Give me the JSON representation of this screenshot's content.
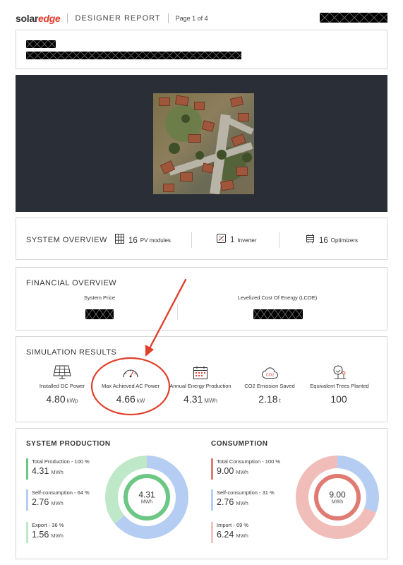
{
  "header": {
    "logo_solar": "solar",
    "logo_edge": "edge",
    "title": "DESIGNER REPORT",
    "page": "Page 1 of 4"
  },
  "system_overview": {
    "title": "SYSTEM OVERVIEW",
    "items": [
      {
        "count": "16",
        "label": "PV modules",
        "icon": "pv-grid-icon"
      },
      {
        "count": "1",
        "label": "Inverter",
        "icon": "inverter-icon"
      },
      {
        "count": "16",
        "label": "Optimizers",
        "icon": "optimizer-icon"
      }
    ]
  },
  "financial_overview": {
    "title": "FINANCIAL OVERVIEW",
    "system_price_label": "System Price",
    "lcoe_label": "Levelized Cost Of Energy (LCOE)"
  },
  "simulation_results": {
    "title": "SIMULATION RESULTS",
    "items": [
      {
        "label": "Installed DC Power",
        "value": "4.80",
        "unit": "kWp",
        "icon": "solar-panel-icon"
      },
      {
        "label": "Max Achieved AC Power",
        "value": "4.66",
        "unit": "kW",
        "icon": "gauge-icon"
      },
      {
        "label": "Annual Energy Production",
        "value": "4.31",
        "unit": "MWh",
        "icon": "calendar-icon"
      },
      {
        "label": "CO2 Emission Saved",
        "value": "2.18",
        "unit": "t",
        "icon": "co2-cloud-icon"
      },
      {
        "label": "Equivalent Trees Planted",
        "value": "100",
        "unit": "",
        "icon": "trees-icon"
      }
    ]
  },
  "system_production": {
    "title": "SYSTEM PRODUCTION",
    "center_value": "4.31",
    "center_unit": "MWh",
    "legend": [
      {
        "label": "Total Production - 100 %",
        "value": "4.31",
        "unit": "MWh",
        "color": "#6cc784"
      },
      {
        "label": "Self-consumption - 64 %",
        "value": "2.76",
        "unit": "MWh",
        "color": "#b5cdf2"
      },
      {
        "label": "Export - 36 %",
        "value": "1.56",
        "unit": "MWh",
        "color": "#bfe8c8"
      }
    ],
    "share_percent": [
      64,
      36
    ],
    "share_colors": [
      "#b5cdf2",
      "#bfe8c8"
    ],
    "ring_color": "#6cc784"
  },
  "consumption": {
    "title": "CONSUMPTION",
    "center_value": "9.00",
    "center_unit": "MWh",
    "legend": [
      {
        "label": "Total Consumption - 100 %",
        "value": "9.00",
        "unit": "MWh",
        "color": "#e07b74"
      },
      {
        "label": "Self-consumption - 31 %",
        "value": "2.76",
        "unit": "MWh",
        "color": "#b5cdf2"
      },
      {
        "label": "Import - 69 %",
        "value": "6.24",
        "unit": "MWh",
        "color": "#f2c3c0"
      }
    ],
    "share_percent": [
      31,
      69
    ],
    "share_colors": [
      "#b5cdf2",
      "#f0bdb9"
    ],
    "ring_color": "#e07b74"
  },
  "annotation_color": "#e0402a"
}
